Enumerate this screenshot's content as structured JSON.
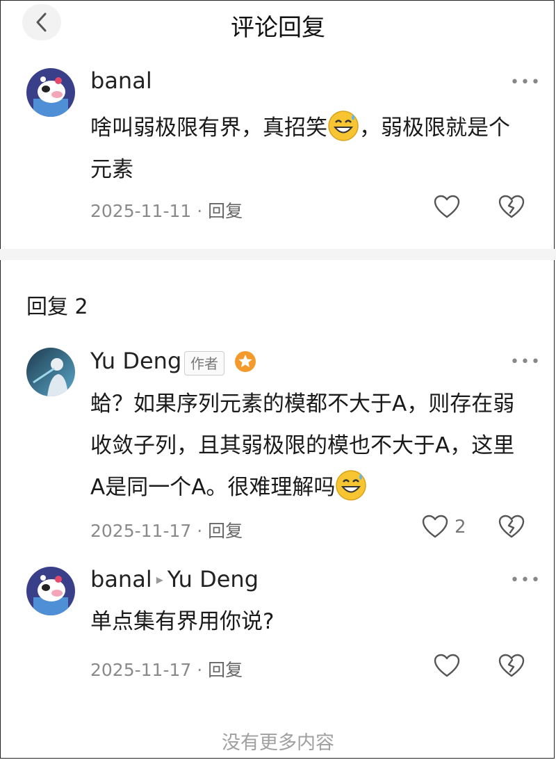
{
  "header": {
    "title": "评论回复"
  },
  "root_comment": {
    "user": "banal",
    "text_before_emoji": "啥叫弱极限有界，真招笑",
    "text_after_emoji": "，弱极限就是个元素",
    "date": "2025-11-11",
    "reply_label": "回复"
  },
  "replies_header": "回复 2",
  "replies": [
    {
      "user": "Yu Deng",
      "author_tag": "作者",
      "text_before_emoji": "蛤？如果序列元素的模都不大于A，则存在弱收敛子列，且其弱极限的模也不大于A，这里A是同一个A。很难理解吗",
      "date": "2025-11-17",
      "reply_label": "回复",
      "likes": "2"
    },
    {
      "user": "banal",
      "reply_to": "Yu Deng",
      "text": "单点集有界用你说?",
      "date": "2025-11-17",
      "reply_label": "回复"
    }
  ],
  "footer": "没有更多内容",
  "icons": {
    "back": "chevron-left-icon",
    "more": "more-dots-icon",
    "like": "heart-outline-icon",
    "dislike": "broken-heart-icon",
    "emoji": "sweat-smile-emoji",
    "badge": "orange-star-badge"
  }
}
